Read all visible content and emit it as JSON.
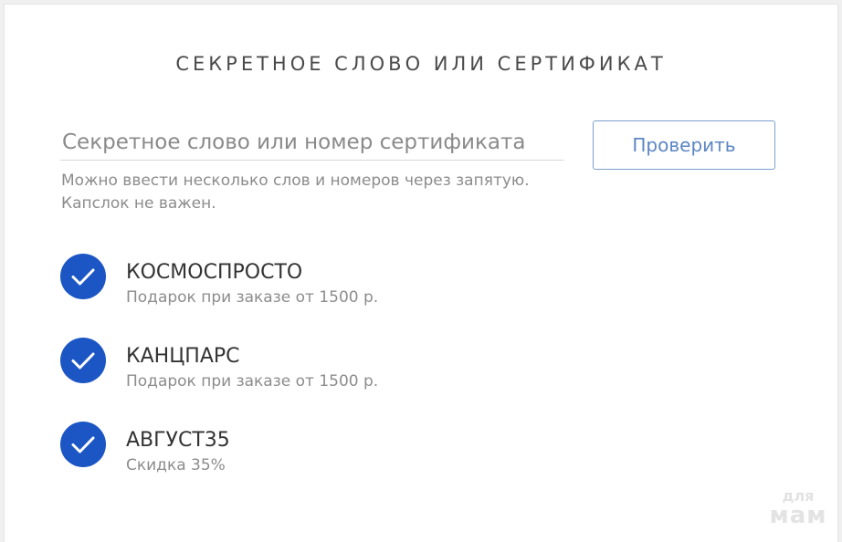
{
  "panel": {
    "title": "СЕКРЕТНОЕ СЛОВО ИЛИ СЕРТИФИКАТ"
  },
  "form": {
    "input_placeholder": "Секретное слово или номер сертификата",
    "input_value": "",
    "hint_line1": "Можно ввести несколько слов и номеров через запятую.",
    "hint_line2": "Капслок не важен.",
    "check_label": "Проверить"
  },
  "codes": [
    {
      "name": "КОСМОСПРОСТО",
      "description": "Подарок при заказе от 1500 р.",
      "status_icon": "check-icon",
      "status_color": "#1c56c4"
    },
    {
      "name": "КАНЦПАРС",
      "description": "Подарок при заказе от 1500 р.",
      "status_icon": "check-icon",
      "status_color": "#1c56c4"
    },
    {
      "name": "АВГУСТ35",
      "description": "Скидка 35%",
      "status_icon": "check-icon",
      "status_color": "#1c56c4"
    }
  ],
  "watermark": {
    "line1": "для",
    "line2": "мам"
  },
  "colors": {
    "accent": "#1c56c4",
    "button_border": "#7b9fd0",
    "button_text": "#5c86c4"
  }
}
